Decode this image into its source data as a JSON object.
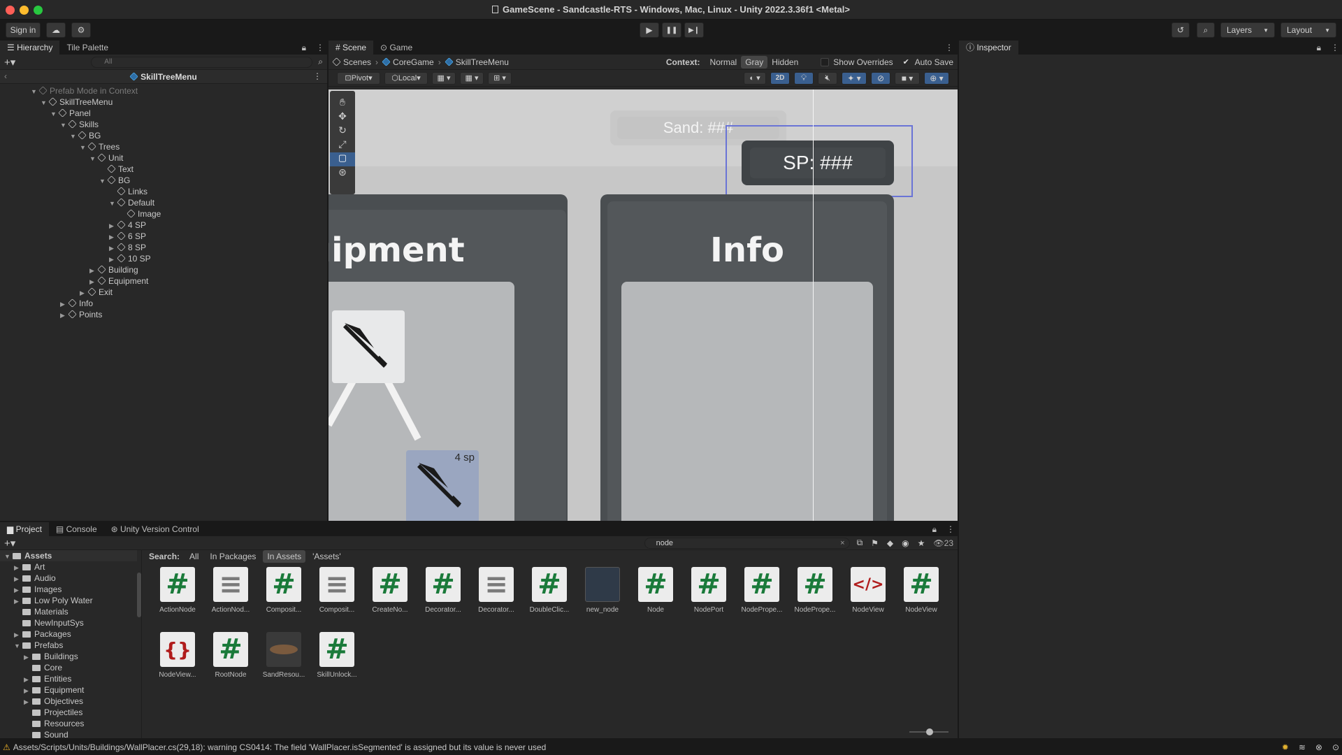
{
  "window": {
    "title": "GameScene - Sandcastle-RTS - Windows, Mac, Linux - Unity 2022.3.36f1 <Metal>"
  },
  "toolbar": {
    "sign_in": "Sign in",
    "layers": "Layers",
    "layout": "Layout"
  },
  "hierarchy": {
    "tabs": [
      "Hierarchy",
      "Tile Palette"
    ],
    "search_placeholder": "All",
    "prefab_title": "SkillTreeMenu",
    "rows": [
      {
        "label": "Prefab Mode in Context",
        "depth": 0,
        "expanded": true,
        "muted": true
      },
      {
        "label": "SkillTreeMenu",
        "depth": 1,
        "expanded": true
      },
      {
        "label": "Panel",
        "depth": 2,
        "expanded": true
      },
      {
        "label": "Skills",
        "depth": 3,
        "expanded": true
      },
      {
        "label": "BG",
        "depth": 4,
        "expanded": true
      },
      {
        "label": "Trees",
        "depth": 5,
        "expanded": true
      },
      {
        "label": "Unit",
        "depth": 6,
        "expanded": true
      },
      {
        "label": "Text",
        "depth": 7,
        "expanded": null
      },
      {
        "label": "BG",
        "depth": 7,
        "expanded": true
      },
      {
        "label": "Links",
        "depth": 8,
        "expanded": null
      },
      {
        "label": "Default",
        "depth": 8,
        "expanded": true
      },
      {
        "label": "Image",
        "depth": 9,
        "expanded": null
      },
      {
        "label": "4 SP",
        "depth": 8,
        "expanded": false
      },
      {
        "label": "6 SP",
        "depth": 8,
        "expanded": false
      },
      {
        "label": "8 SP",
        "depth": 8,
        "expanded": false
      },
      {
        "label": "10 SP",
        "depth": 8,
        "expanded": false
      },
      {
        "label": "Building",
        "depth": 6,
        "expanded": false
      },
      {
        "label": "Equipment",
        "depth": 6,
        "expanded": false
      },
      {
        "label": "Exit",
        "depth": 5,
        "expanded": false
      },
      {
        "label": "Info",
        "depth": 3,
        "expanded": false
      },
      {
        "label": "Points",
        "depth": 3,
        "expanded": false
      }
    ]
  },
  "scene": {
    "tabs": [
      "Scene",
      "Game"
    ],
    "breadcrumb": [
      "Scenes",
      "CoreGame",
      "SkillTreeMenu"
    ],
    "context_label": "Context:",
    "context_options": [
      "Normal",
      "Gray",
      "Hidden"
    ],
    "show_overrides": "Show Overrides",
    "auto_save": "Auto Save",
    "pivot": "Pivot",
    "local": "Local",
    "mode_2d": "2D",
    "canvas": {
      "sand_label": "Sand: ###",
      "sp_label": "SP: ###",
      "equipment_title": "uipment",
      "info_title": "Info",
      "node_cost": "4 sp"
    }
  },
  "inspector": {
    "tab": "Inspector"
  },
  "project": {
    "tabs": [
      "Project",
      "Console",
      "Unity Version Control"
    ],
    "search_value": "node",
    "count": "23",
    "search_label": "Search:",
    "scopes": [
      "All",
      "In Packages",
      "In Assets",
      "'Assets'"
    ],
    "tree": [
      {
        "label": "Assets",
        "depth": 0,
        "expanded": true,
        "bold": true
      },
      {
        "label": "Art",
        "depth": 1,
        "expanded": false
      },
      {
        "label": "Audio",
        "depth": 1,
        "expanded": false
      },
      {
        "label": "Images",
        "depth": 1,
        "expanded": false
      },
      {
        "label": "Low Poly Water",
        "depth": 1,
        "expanded": false
      },
      {
        "label": "Materials",
        "depth": 1,
        "expanded": null
      },
      {
        "label": "NewInputSys",
        "depth": 1,
        "expanded": null
      },
      {
        "label": "Packages",
        "depth": 1,
        "expanded": false
      },
      {
        "label": "Prefabs",
        "depth": 1,
        "expanded": true
      },
      {
        "label": "Buildings",
        "depth": 2,
        "expanded": false
      },
      {
        "label": "Core",
        "depth": 2,
        "expanded": null
      },
      {
        "label": "Entities",
        "depth": 2,
        "expanded": false
      },
      {
        "label": "Equipment",
        "depth": 2,
        "expanded": false
      },
      {
        "label": "Objectives",
        "depth": 2,
        "expanded": false
      },
      {
        "label": "Projectiles",
        "depth": 2,
        "expanded": null
      },
      {
        "label": "Resources",
        "depth": 2,
        "expanded": null
      },
      {
        "label": "Sound",
        "depth": 2,
        "expanded": null
      }
    ],
    "assets": [
      {
        "label": "ActionNode",
        "kind": "cs"
      },
      {
        "label": "ActionNod...",
        "kind": "text"
      },
      {
        "label": "Composit...",
        "kind": "cs"
      },
      {
        "label": "Composit...",
        "kind": "text"
      },
      {
        "label": "CreateNo...",
        "kind": "cs"
      },
      {
        "label": "Decorator...",
        "kind": "cs"
      },
      {
        "label": "Decorator...",
        "kind": "text"
      },
      {
        "label": "DoubleClic...",
        "kind": "cs"
      },
      {
        "label": "new_node",
        "kind": "preview"
      },
      {
        "label": "Node",
        "kind": "cs"
      },
      {
        "label": "NodePort",
        "kind": "cs"
      },
      {
        "label": "NodePrope...",
        "kind": "cs"
      },
      {
        "label": "NodePrope...",
        "kind": "cs"
      },
      {
        "label": "NodeView",
        "kind": "xml"
      },
      {
        "label": "NodeView",
        "kind": "cs"
      },
      {
        "label": "NodeView...",
        "kind": "json"
      },
      {
        "label": "RootNode",
        "kind": "cs"
      },
      {
        "label": "SandResou...",
        "kind": "prefab"
      },
      {
        "label": "SkillUnlock...",
        "kind": "cs"
      }
    ]
  },
  "status": {
    "message": "Assets/Scripts/Units/Buildings/WallPlacer.cs(29,18): warning CS0414: The field 'WallPlacer.isSegmented' is assigned but its value is never used"
  },
  "colors": {
    "accent": "#4a7fd1",
    "cs_green": "#1a7a3a",
    "warning": "#f0b429"
  }
}
